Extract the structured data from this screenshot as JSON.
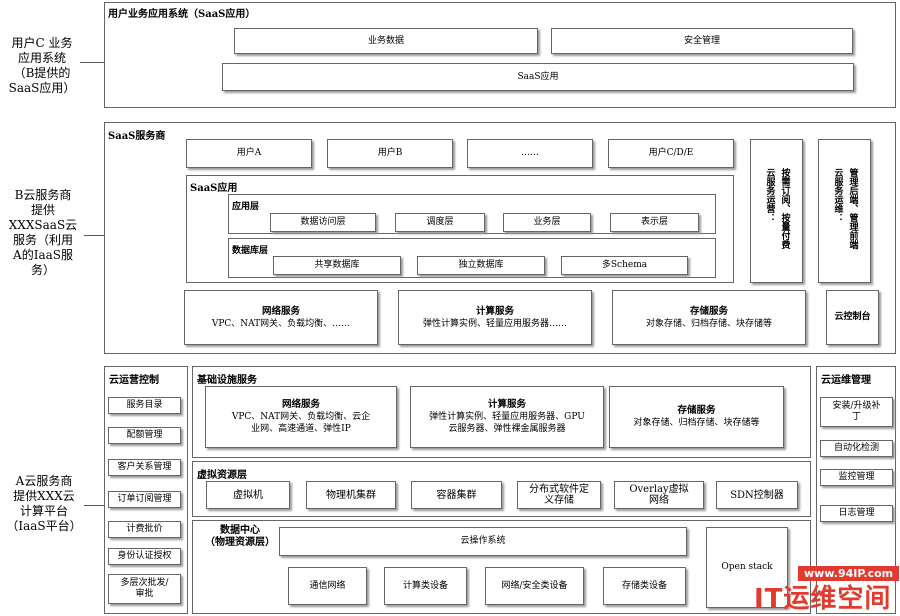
{
  "left_labels": {
    "user_system": "用户C 业务\n应用系统\n（B提供的\nSaaS应用）",
    "saas_provider": "B云服务商\n提供\nXXXSaaS云\n服务（利用\nA的IaaS服\n务）",
    "iaas_platform": "A云服务商\n提供XXX云\n计算平台\n（IaaS平台）"
  },
  "section1": {
    "title": "用户业务应用系统（SaaS应用）",
    "business_data": "业务数据",
    "security_mgmt": "安全管理",
    "saas_app": "SaaS应用"
  },
  "section2": {
    "title": "SaaS服务商",
    "users": [
      "用户A",
      "用户B",
      "……",
      "用户C/D/E"
    ],
    "saas_app_title": "SaaS应用",
    "app_layer": {
      "title": "应用层",
      "items": [
        "数据访问层",
        "调度层",
        "业务层",
        "表示层"
      ]
    },
    "db_layer": {
      "title": "数据库层",
      "items": [
        "共享数据库",
        "独立数据库",
        "多Schema"
      ]
    },
    "ops_box": [
      "云服务运营：",
      "按需订阅、按量付费"
    ],
    "maint_box": [
      "云服务运维：",
      "管理后端、管理前端"
    ],
    "services": [
      {
        "title": "网络服务",
        "desc": "VPC、NAT网关、负载均衡、……"
      },
      {
        "title": "计算服务",
        "desc": "弹性计算实例、轻量应用服务器……"
      },
      {
        "title": "存储服务",
        "desc": "对象存储、归档存储、块存储等"
      }
    ],
    "console": "云控制台"
  },
  "section3": {
    "ops_control": {
      "title": "云运营控制",
      "items": [
        "服务目录",
        "配额管理",
        "客户关系管理",
        "订单订阅管理",
        "计费批价",
        "身份认证授权",
        "多层次批发/\n审批"
      ]
    },
    "infra": {
      "title": "基础设施服务",
      "services": [
        {
          "title": "网络服务",
          "desc": "VPC、NAT网关、负载均衡、云企\n业网、高速通道、弹性IP"
        },
        {
          "title": "计算服务",
          "desc": "弹性计算实例、轻量应用服务器、GPU\n云服务器、弹性裸金属服务器"
        },
        {
          "title": "存储服务",
          "desc": "对象存储、归档存储、块存储等"
        }
      ]
    },
    "virtual": {
      "title": "虚拟资源层",
      "items": [
        "虚拟机",
        "物理机集群",
        "容器集群",
        "分布式软件定\n义存储",
        "Overlay虚拟\n网络",
        "SDN控制器"
      ]
    },
    "datacenter": {
      "title": "数据中心\n（物理资源层）",
      "cloud_os": "云操作系统",
      "items": [
        "通信网络",
        "计算类设备",
        "网络/安全类设备",
        "存储类设备"
      ],
      "openstack": "Open stack"
    },
    "maint": {
      "title": "云运维管理",
      "items": [
        "安装/升级补\n丁",
        "自动化检测",
        "监控管理",
        "日志管理"
      ]
    }
  },
  "watermark": {
    "url": "www.94IP.com",
    "brand": "IT运维空间"
  }
}
